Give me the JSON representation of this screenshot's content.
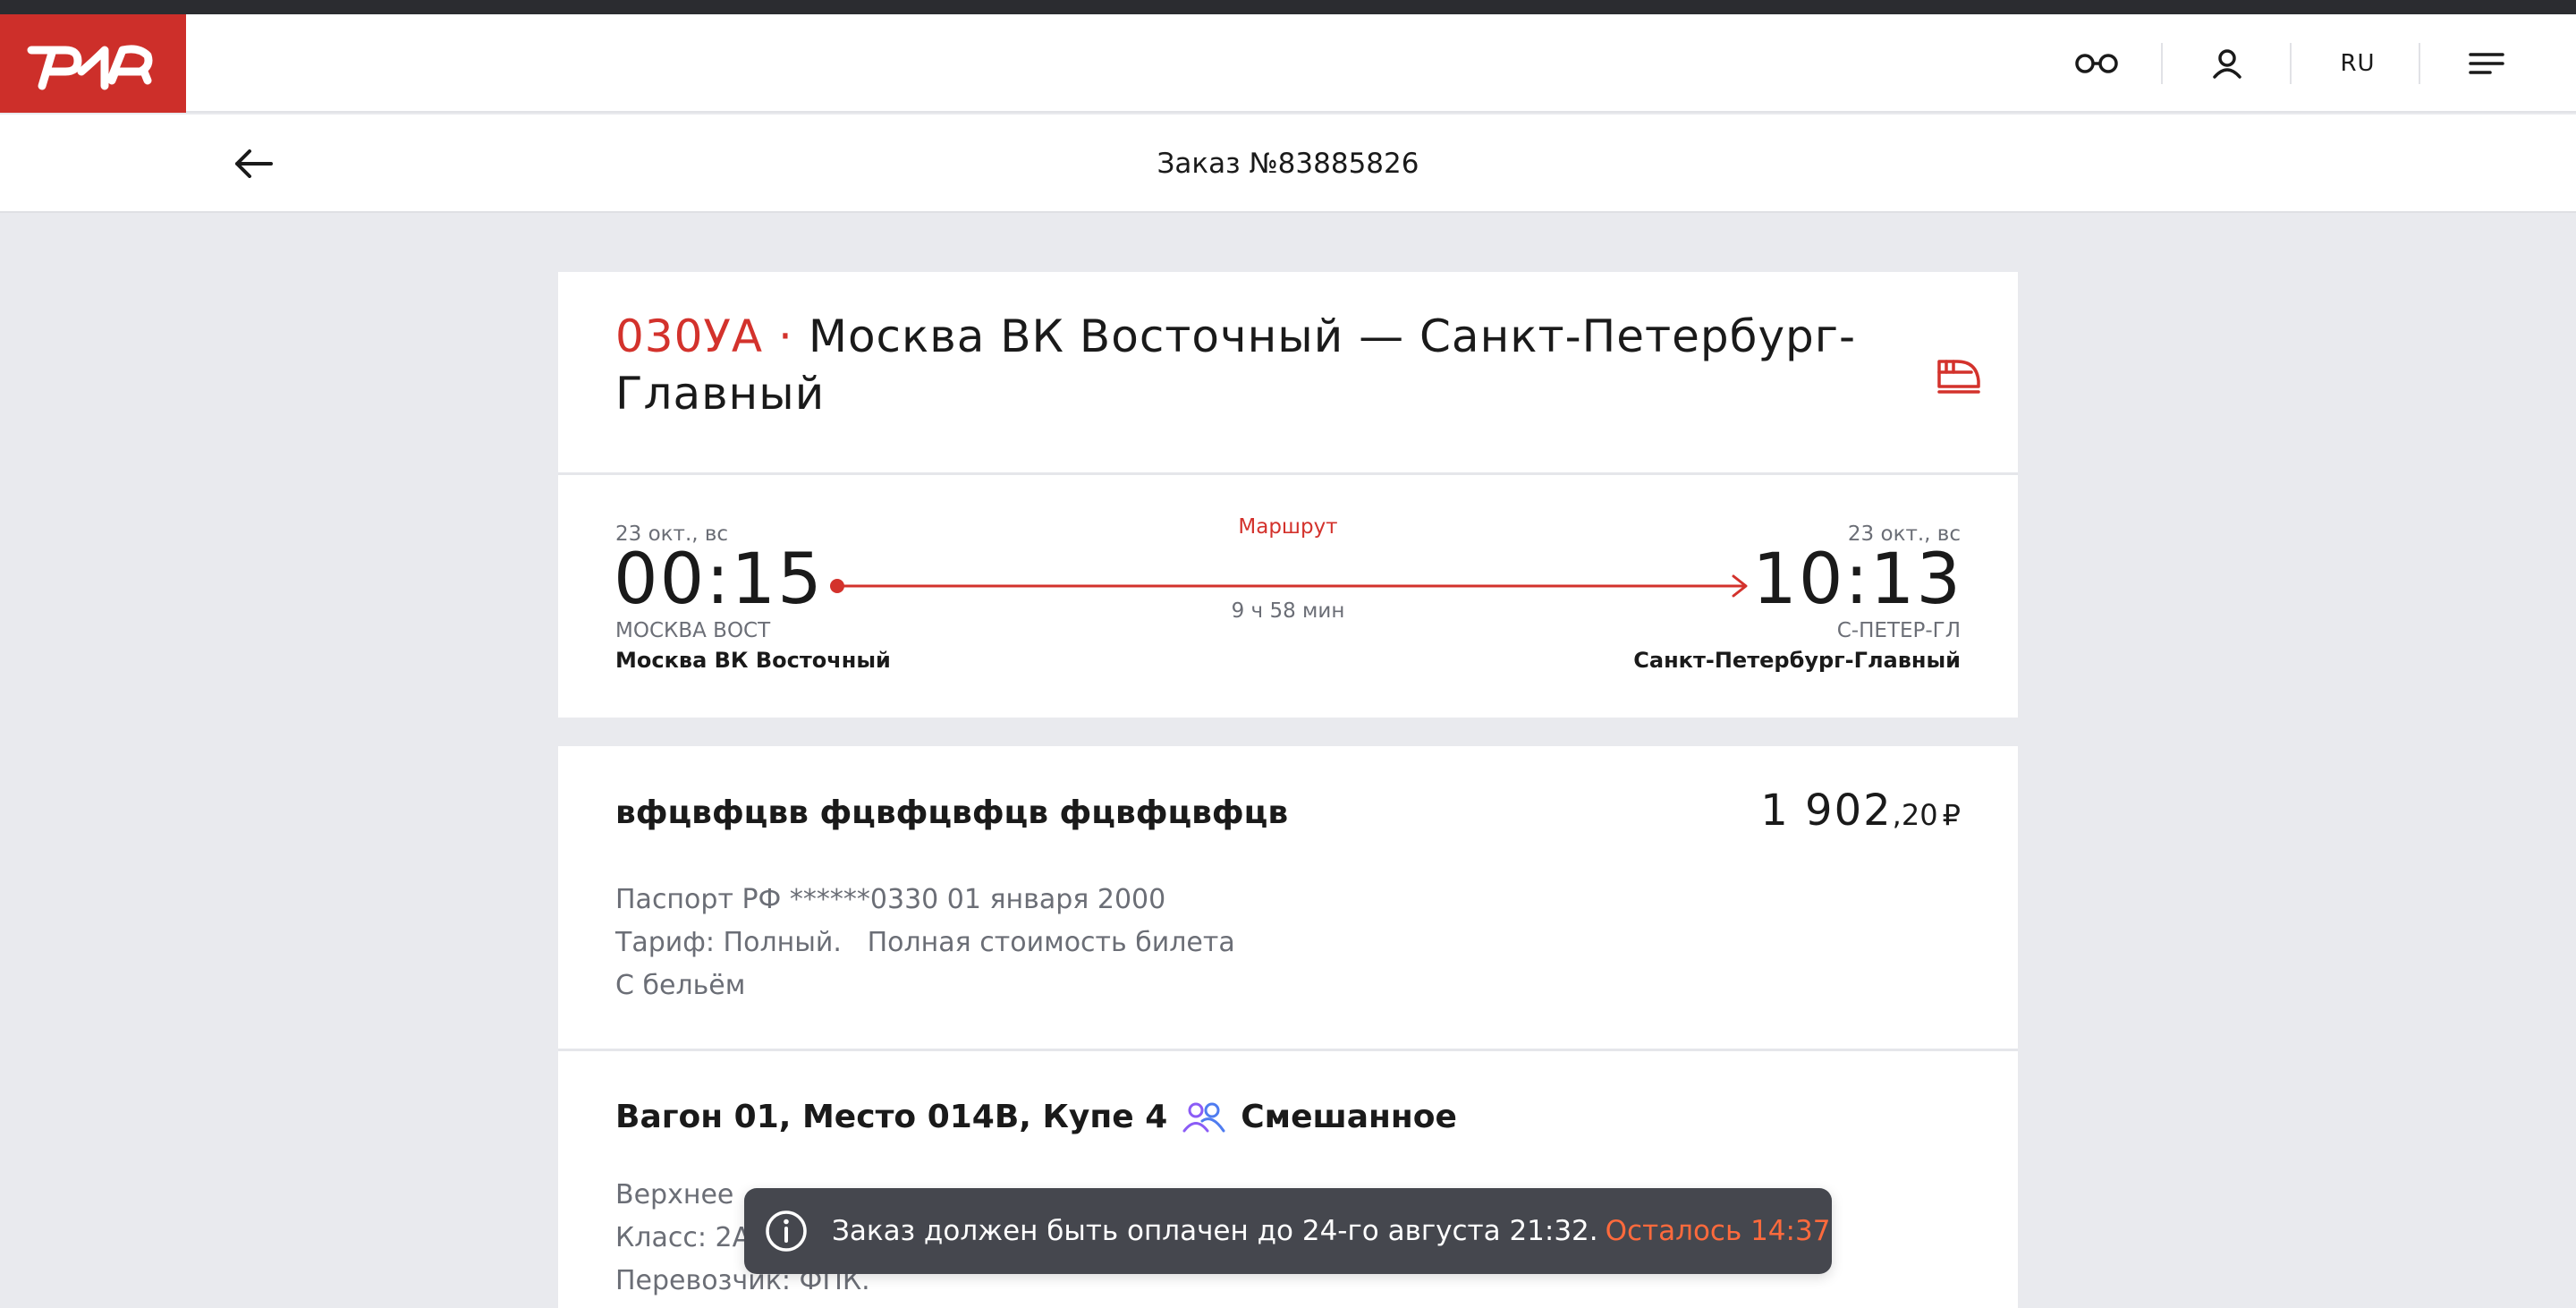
{
  "header": {
    "logo_alt": "РЖД",
    "lang": "RU",
    "icons": [
      "accessibility-glasses-icon",
      "user-icon",
      "menu-icon"
    ]
  },
  "subheader": {
    "title": "Заказ №83885826"
  },
  "route": {
    "train_number": "030УА ·",
    "route_name": "Москва ВК Восточный — Санкт-Петербург-Главный",
    "departure": {
      "date": "23 окт., вс",
      "time": "00:15",
      "code": "МОСКВА ВОСТ",
      "station": "Москва ВК Восточный"
    },
    "arrival": {
      "date": "23 окт., вс",
      "time": "10:13",
      "code": "С-ПЕТЕР-ГЛ",
      "station": "Санкт-Петербург-Главный"
    },
    "route_link": "Маршрут",
    "duration": "9 ч 58 мин"
  },
  "passenger": {
    "name": "вфцвфцвв фцвфцвфцв фцвфцвфцв",
    "price_main": "1 902",
    "price_cents": ",20",
    "price_currency": "₽",
    "document": "Паспорт РФ ******0330 01 января 2000",
    "tariff": "Тариф: Полный.   Полная стоимость билета",
    "linen": "С бельём",
    "seat": "Вагон 01, Место 014В, Купе 4",
    "compartment_type": "Смешанное",
    "berth": "Верхнее",
    "class": "Класс: 2А",
    "carrier": "Перевозчик: ФПК."
  },
  "toast": {
    "message": "Заказ должен быть оплачен до 24-го августа 21:32.",
    "remaining": "Осталось 14:37"
  },
  "colors": {
    "brand_red": "#cd2f2a",
    "accent_red": "#d3322c",
    "toast_bg": "#45474e",
    "toast_accent": "#ff6a3c",
    "page_bg": "#e9eaee"
  }
}
